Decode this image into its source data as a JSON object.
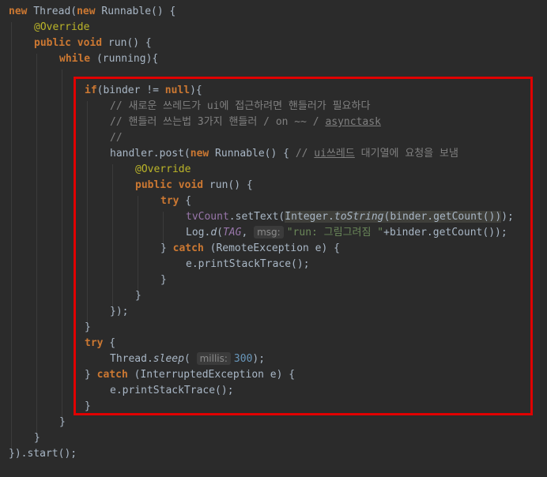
{
  "code": {
    "l1_new": "new",
    "l1_thread": " Thread(",
    "l1_new2": "new",
    "l1_runnable": " Runnable() {",
    "l2_override": "@Override",
    "l3_public": "public",
    "l3_void": " void",
    "l3_run": " run() {",
    "l4_while": "while",
    "l4_running": " (running){",
    "l5_if": "if",
    "l5_binder": "(binder != ",
    "l5_null": "null",
    "l5_end": "){",
    "l6_comment": "// 새로운 쓰레드가 ui에 접근하려면 핸들러가 필요하다",
    "l7_comment_a": "// 핸들러 쓰는법 3가지 핸들러 / on ~~ / ",
    "l7_comment_b": "asynctask",
    "l8_comment": "//",
    "l9_handler": "handler.post(",
    "l9_new": "new",
    "l9_runnable": " Runnable() { ",
    "l9_comment_a": "// ",
    "l9_comment_b": "ui쓰레드",
    "l9_comment_c": " 대기열에 요청을 보냄",
    "l10_override": "@Override",
    "l11_public": "public",
    "l11_void": " void",
    "l11_run": " run() {",
    "l12_try": "try",
    "l12_brace": " {",
    "l13_field": "tvCount",
    "l13_settext": ".setText(",
    "l13_integer": "Integer.",
    "l13_tostring": "toString",
    "l13_binder": "(binder.getCount())",
    "l13_semi": ");",
    "l14_log": "Log.",
    "l14_d": "d",
    "l14_paren": "(",
    "l14_tag": "TAG",
    "l14_comma": ", ",
    "l14_hint": "msg:",
    "l14_string": "\"run: 그림그려짐 \"",
    "l14_rest": "+binder.getCount());",
    "l15_close": "} ",
    "l15_catch": "catch",
    "l15_rest": " (RemoteException e) {",
    "l16_print": "e.printStackTrace();",
    "l17": "}",
    "l18": "}",
    "l19": "});",
    "l20": "}",
    "l21_try": "try",
    "l21_brace": " {",
    "l22_thread": "Thread.",
    "l22_sleep": "sleep",
    "l22_paren": "( ",
    "l22_hint": "millis:",
    "l22_num": "300",
    "l22_end": ");",
    "l23_close": "} ",
    "l23_catch": "catch",
    "l23_rest": " (InterruptedException e) {",
    "l24_print": "e.printStackTrace();",
    "l25": "}",
    "l26": "}",
    "l27": "}",
    "l28": "}).start();"
  },
  "colors": {
    "background": "#2b2b2b",
    "keyword": "#cc7832",
    "annotation": "#bbb529",
    "comment": "#808080",
    "string": "#6a8759",
    "number": "#6897bb",
    "field": "#9876aa",
    "text": "#a9b7c6",
    "highlight_box": "#e00000"
  }
}
